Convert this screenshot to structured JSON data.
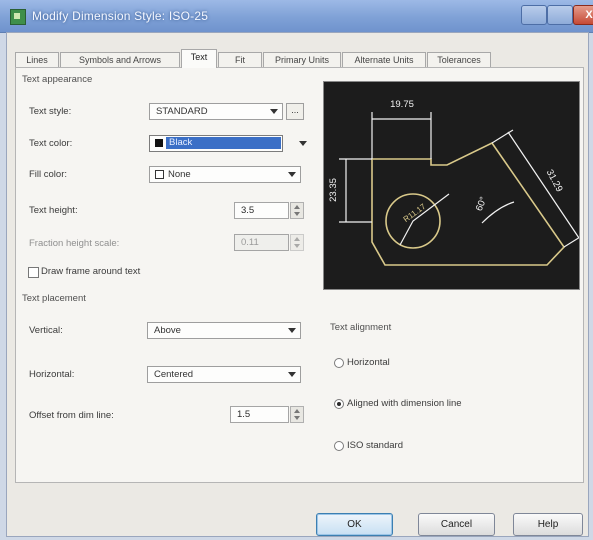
{
  "window": {
    "title": "Modify Dimension Style: ISO-25",
    "close_glyph": "X",
    "minimize_glyph": "",
    "maximize_glyph": ""
  },
  "tabs": [
    {
      "label": "Lines",
      "active": false
    },
    {
      "label": "Symbols and Arrows",
      "active": false
    },
    {
      "label": "Text",
      "active": true
    },
    {
      "label": "Fit",
      "active": false
    },
    {
      "label": "Primary Units",
      "active": false
    },
    {
      "label": "Alternate Units",
      "active": false
    },
    {
      "label": "Tolerances",
      "active": false
    }
  ],
  "appearance": {
    "group_label": "Text appearance",
    "text_style_label": "Text style:",
    "text_style_value": "STANDARD",
    "ellipsis": "...",
    "text_color_label": "Text color:",
    "text_color_value": "Black",
    "fill_color_label": "Fill color:",
    "fill_color_value": "None",
    "text_height_label": "Text height:",
    "text_height_value": "3.5",
    "fraction_label": "Fraction height scale:",
    "fraction_value": "0.11",
    "draw_frame_label": "Draw frame around text"
  },
  "placement": {
    "group_label": "Text placement",
    "vertical_label": "Vertical:",
    "vertical_value": "Above",
    "horizontal_label": "Horizontal:",
    "horizontal_value": "Centered",
    "offset_label": "Offset from dim line:",
    "offset_value": "1.5"
  },
  "alignment": {
    "group_label": "Text alignment",
    "options": [
      {
        "label": "Horizontal",
        "checked": false
      },
      {
        "label": "Aligned with dimension line",
        "checked": true
      },
      {
        "label": "ISO standard",
        "checked": false
      }
    ]
  },
  "preview": {
    "dim_top": "19.75",
    "dim_left": "23.35",
    "dim_right": "31.29",
    "dim_angle": "60°",
    "dim_radius": "R11.17"
  },
  "buttons": {
    "ok": "OK",
    "cancel": "Cancel",
    "help": "Help"
  },
  "colors": {
    "preview_bg": "#1c1c1c",
    "preview_lines": "#d9c98a",
    "preview_text": "#f2f2f2",
    "selection": "#3b6fc6"
  }
}
